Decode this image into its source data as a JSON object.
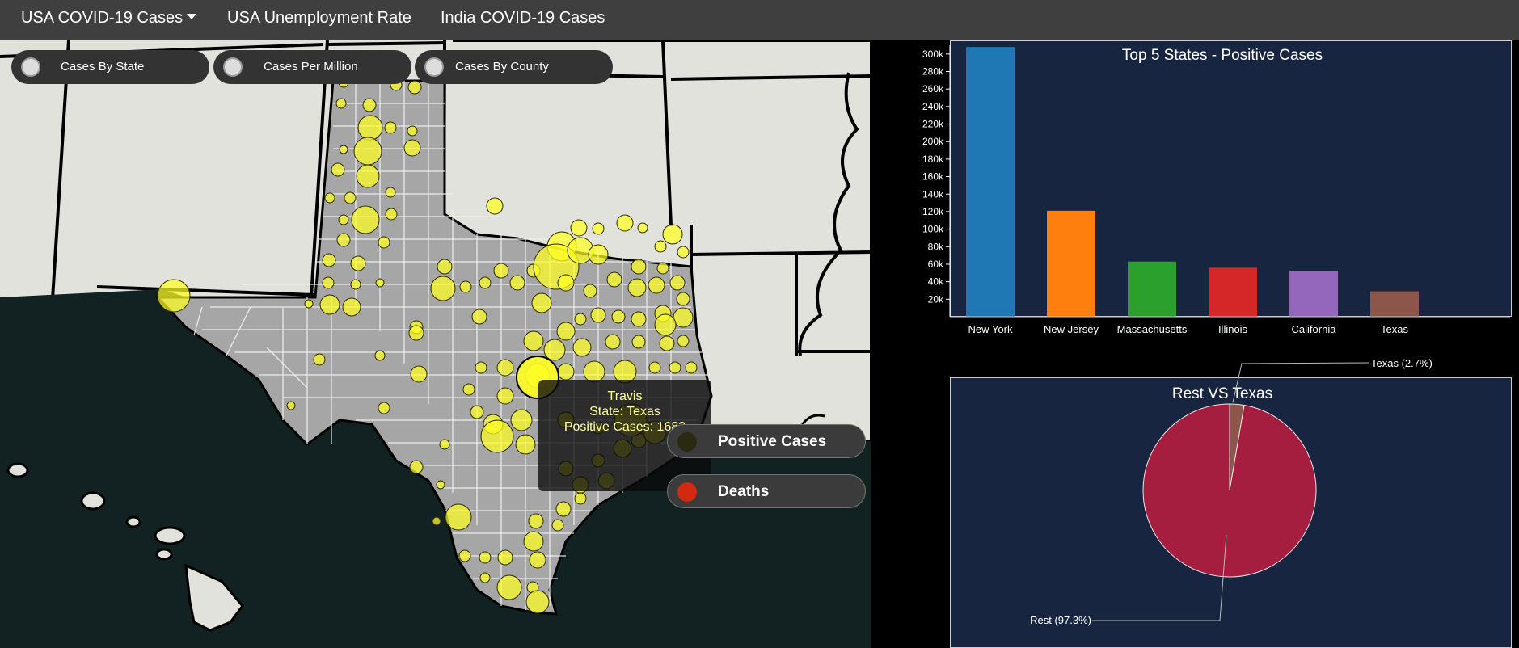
{
  "nav": {
    "items": [
      {
        "label": "USA COVID-19 Cases"
      },
      {
        "label": "USA Unemployment Rate"
      },
      {
        "label": "India COVID-19 Cases"
      }
    ]
  },
  "map": {
    "toggles": [
      {
        "label": "Cases By State"
      },
      {
        "label": "Cases Per Million"
      },
      {
        "label": "Cases By County"
      }
    ],
    "tooltip": {
      "county": "Travis",
      "state": "State: Texas",
      "cases": "Positive Cases: 1683"
    },
    "legend": [
      {
        "label": "Positive Cases",
        "color": "#d8d800"
      },
      {
        "label": "Deaths",
        "color": "#d22a10"
      }
    ],
    "colors": {
      "ocean": "#122222",
      "land": "#e2e2dc",
      "texas": "#a6a6a6",
      "bubble": "#ffff22"
    }
  },
  "chart_data": [
    {
      "type": "bar",
      "title": "Top 5 States - Positive Cases",
      "categories": [
        "New York",
        "New Jersey",
        "Massachusetts",
        "Illinois",
        "California",
        "Texas"
      ],
      "values": [
        308000,
        121000,
        63000,
        56000,
        52000,
        29000
      ],
      "colors": [
        "#1f77b4",
        "#ff7f0e",
        "#2ca02c",
        "#d62728",
        "#9467bd",
        "#8c564b"
      ],
      "yticks": [
        "20k",
        "40k",
        "60k",
        "80k",
        "100k",
        "120k",
        "140k",
        "160k",
        "180k",
        "200k",
        "220k",
        "240k",
        "260k",
        "280k",
        "300k"
      ],
      "ylim": [
        0,
        310000
      ],
      "grid": false
    },
    {
      "type": "pie",
      "title": "Rest VS Texas",
      "labels": [
        "Rest (97.3%)",
        "Texas (2.7%)"
      ],
      "values": [
        97.3,
        2.7
      ],
      "colors": [
        "#a51e40",
        "#8c564b"
      ]
    }
  ]
}
